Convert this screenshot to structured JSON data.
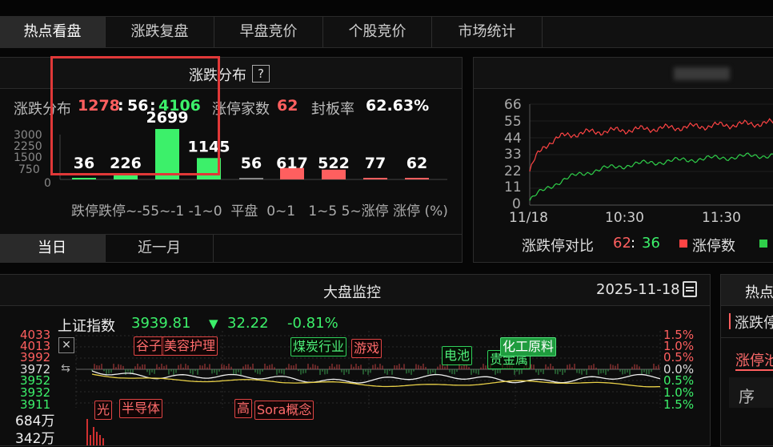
{
  "tabs": [
    {
      "label": "热点看盘",
      "active": true
    },
    {
      "label": "涨跌复盘",
      "active": false
    },
    {
      "label": "早盘竞价",
      "active": false
    },
    {
      "label": "个股竞价",
      "active": false
    },
    {
      "label": "市场统计",
      "active": false
    }
  ],
  "distribution": {
    "title": "涨跌分布",
    "help": "?",
    "ratio_label": "涨跌分布",
    "up": "1278",
    "sep1": ":",
    "flat": "56",
    "sep2": ":",
    "down": "4106",
    "limit_label": "涨停家数",
    "limit_count": "62",
    "seal_label": "封板率",
    "seal_rate": "62.63%",
    "y_ticks": [
      "3000",
      "2250",
      "1500",
      "750",
      "0"
    ],
    "bars": [
      {
        "cat": "跌停",
        "value": 36,
        "label": "36",
        "color": "#3cf06a"
      },
      {
        "cat": "跌停~-5",
        "value": 226,
        "label": "226",
        "color": "#3cf06a"
      },
      {
        "cat": "-5~-1",
        "value": 2699,
        "label": "2699",
        "color": "#3cf06a"
      },
      {
        "cat": "-1~0",
        "value": 1145,
        "label": "1145",
        "color": "#3cf06a"
      },
      {
        "cat": "平盘",
        "value": 56,
        "label": "56",
        "color": "#888888"
      },
      {
        "cat": "0~1",
        "value": 617,
        "label": "617",
        "color": "#ff5f5f"
      },
      {
        "cat": "1~5",
        "value": 522,
        "label": "522",
        "color": "#ff5f5f"
      },
      {
        "cat": "5~涨停",
        "value": 77,
        "label": "77",
        "color": "#ff5f5f"
      },
      {
        "cat": "涨停",
        "value": 62,
        "label": "62",
        "color": "#ff5f5f"
      }
    ],
    "x_axis_text": "跌停跌停~-55~-1 -1~0  平盘  0~1   1~5 5~涨停 涨停 (%)",
    "period_tabs": [
      {
        "label": "当日",
        "active": true
      },
      {
        "label": "近一月",
        "active": false
      }
    ]
  },
  "limit_chart": {
    "y_ticks": [
      "66",
      "55",
      "44",
      "33",
      "22",
      "11",
      "0"
    ],
    "x_ticks": [
      "11/18",
      "10:30",
      "11:30"
    ],
    "legend_label": "涨跌停对比",
    "ratio_up": "62",
    "ratio_sep": ":",
    "ratio_down": "36",
    "legend_up": "涨停数",
    "colors": {
      "up": "#ff4444",
      "down": "#2fcf4a"
    }
  },
  "monitor": {
    "title": "大盘监控",
    "date": "2025-11-18",
    "index_name": "上证指数",
    "index_value": "3939.81",
    "arrow": "▼",
    "change": "32.22",
    "change_pct": "-0.81%",
    "left_ticks_red": [
      "4033",
      "4013",
      "3992"
    ],
    "left_mid": "3972",
    "left_ticks_green": [
      "3952",
      "3932",
      "3911"
    ],
    "right_ticks_red": [
      "1.5%",
      "1.0%",
      "0.5%"
    ],
    "right_mid": "0.0%",
    "right_ticks_green": [
      "0.5%",
      "1.0%",
      "1.5%"
    ],
    "volume_ticks": [
      "684万",
      "342万"
    ],
    "tags_top": [
      {
        "text": "谷子",
        "style": "r"
      },
      {
        "text": "美容护理",
        "style": "r"
      },
      {
        "text": "煤炭行业",
        "style": "g"
      },
      {
        "text": "游戏",
        "style": "r"
      },
      {
        "text": "电池",
        "style": "g"
      },
      {
        "text": "贵金属",
        "style": "g"
      },
      {
        "text": "化工原料",
        "style": "gf"
      }
    ],
    "tags_bottom": [
      {
        "text": "光",
        "style": "r"
      },
      {
        "text": "半导体",
        "style": "r"
      },
      {
        "text": "高",
        "style": "r"
      },
      {
        "text": "Sora概念",
        "style": "r"
      }
    ]
  },
  "side": {
    "title": "热点",
    "item1": "涨跌停",
    "item2": "涨停池",
    "item3": "序"
  }
}
